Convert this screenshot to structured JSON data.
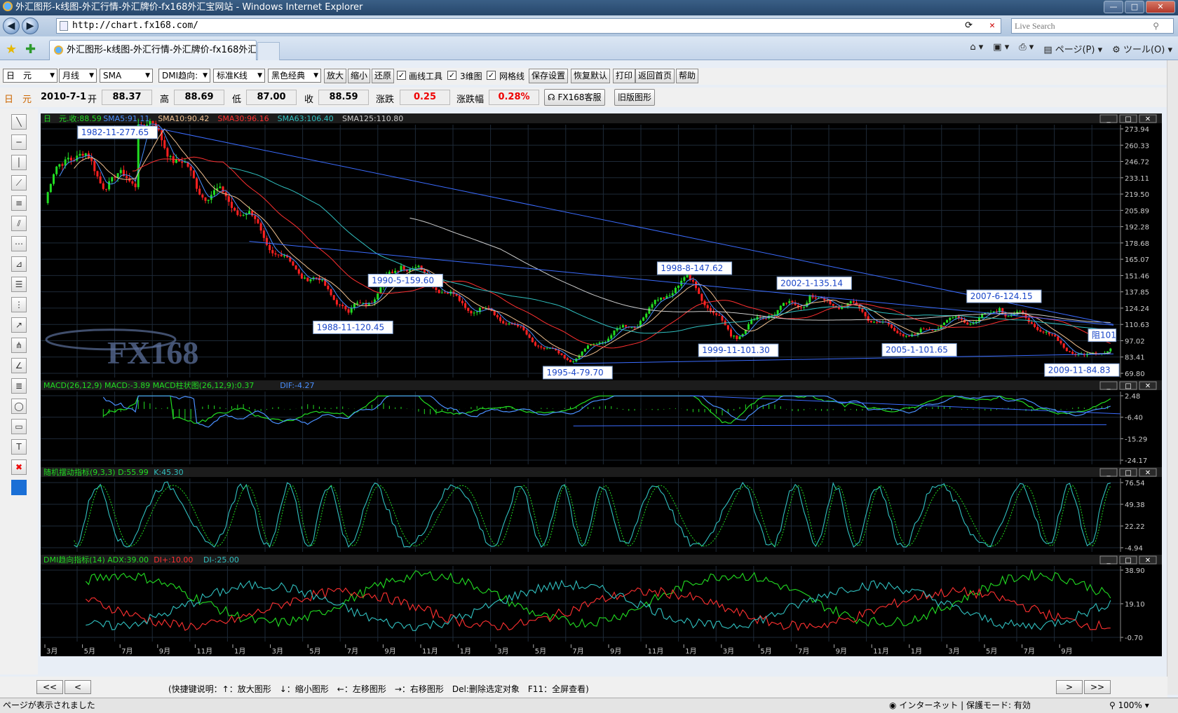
{
  "window": {
    "title": "外汇图形-k线图-外汇行情-外汇牌价-fx168外汇宝网站 - Windows Internet Explorer",
    "min": "—",
    "max": "□",
    "close": "✕"
  },
  "address": {
    "url": "http://chart.fx168.com/",
    "search_placeholder": "Live Search"
  },
  "tab": {
    "title": "外汇图形-k线图-外汇行情-外汇牌价-fx168外汇..."
  },
  "commands": {
    "page": "ページ(P)",
    "tools": "ツール(O)"
  },
  "toolbar": {
    "symbol": "日　元",
    "period": "月线",
    "ma": "SMA",
    "indicator": "DMI趋向:",
    "style": "标准K线",
    "theme": "黑色经典",
    "zoom_in": "放大",
    "zoom_out": "缩小",
    "restore": "还原",
    "draw_tools": "画线工具",
    "three_d": "3维图",
    "grid": "网格线",
    "save_settings": "保存设置",
    "reset": "恢复默认",
    "print": "打印",
    "home": "返回首页",
    "help": "帮助"
  },
  "quote": {
    "symbol": "日　元",
    "date": "2010-7-1",
    "open_label": "开",
    "open": "88.37",
    "high_label": "高",
    "high": "88.69",
    "low_label": "低",
    "low": "87.00",
    "close_label": "收",
    "close": "88.59",
    "change_label": "涨跌",
    "change": "0.25",
    "pct_label": "涨跌幅",
    "pct": "0.28%",
    "service_btn": "FX168客服",
    "old_chart_btn": "旧版图形"
  },
  "panels": {
    "main_header": [
      {
        "text": "日　元.收:88.59",
        "color": "#22dd22"
      },
      {
        "text": "SMA5:91.11",
        "color": "#4a90ff"
      },
      {
        "text": "SMA10:90.42",
        "color": "#f0c090"
      },
      {
        "text": "SMA30:96.16",
        "color": "#ff3030"
      },
      {
        "text": "SMA63:106.40",
        "color": "#30c0c0"
      },
      {
        "text": "SMA125:110.80",
        "color": "#cccccc"
      }
    ],
    "macd_header": [
      {
        "text": "MACD(26,12,9) MACD:-3.89 MACD柱状图(26,12,9):0.37",
        "color": "#22dd22"
      },
      {
        "text": "DIF:-4.27",
        "color": "#4a90ff"
      }
    ],
    "kdj_header": [
      {
        "text": "随机摆动指标(9,3,3) D:55.99",
        "color": "#22dd22"
      },
      {
        "text": "K:45.30",
        "color": "#30c0c0"
      }
    ],
    "dmi_header": [
      {
        "text": "DMI趋向指标(14) ADX:39.00",
        "color": "#22dd22"
      },
      {
        "text": "DI+:10.00",
        "color": "#ff3030"
      },
      {
        "text": "DI-:25.00",
        "color": "#30c0c0"
      }
    ],
    "main_ticks": [
      "273.94",
      "260.33",
      "246.72",
      "233.11",
      "219.50",
      "205.89",
      "192.28",
      "178.68",
      "165.07",
      "151.46",
      "137.85",
      "124.24",
      "110.63",
      "97.02",
      "83.41",
      "69.80"
    ],
    "macd_ticks": [
      "2.48",
      "-6.40",
      "-15.29",
      "-24.17"
    ],
    "kdj_ticks": [
      "76.54",
      "49.38",
      "22.22",
      "-4.94"
    ],
    "dmi_ticks": [
      "38.90",
      "19.10",
      "-0.70"
    ],
    "annotations": [
      "1982-11-277.65",
      "1990-5-159.60",
      "1988-11-120.45",
      "1995-4-79.70",
      "1998-8-147.62",
      "1999-11-101.30",
      "2002-1-135.14",
      "2005-1-101.65",
      "2007-6-124.15",
      "2009-11-84.83",
      "阻101"
    ],
    "x_ticks": [
      "3月",
      "5月",
      "7月",
      "9月",
      "11月",
      "1月",
      "3月",
      "5月",
      "7月",
      "9月",
      "11月",
      "1月",
      "3月",
      "5月",
      "7月",
      "9月",
      "11月",
      "1月",
      "3月",
      "5月",
      "7月",
      "9月",
      "11月",
      "1月",
      "3月",
      "5月",
      "7月",
      "9月"
    ],
    "watermark": "FX168",
    "panel_btns": [
      "_",
      "□",
      "✕"
    ]
  },
  "chart_data": {
    "type": "line",
    "title": "日　元",
    "period": "月线",
    "key_points": [
      {
        "label": "1982-11",
        "value": 277.65
      },
      {
        "label": "1988-11",
        "value": 120.45
      },
      {
        "label": "1990-5",
        "value": 159.6
      },
      {
        "label": "1995-4",
        "value": 79.7
      },
      {
        "label": "1998-8",
        "value": 147.62
      },
      {
        "label": "1999-11",
        "value": 101.3
      },
      {
        "label": "2002-1",
        "value": 135.14
      },
      {
        "label": "2005-1",
        "value": 101.65
      },
      {
        "label": "2007-6",
        "value": 124.15
      },
      {
        "label": "2009-11",
        "value": 84.83
      }
    ],
    "ylim": [
      69.8,
      273.94
    ]
  },
  "bottom": {
    "first": "<<",
    "prev": "<",
    "next": ">",
    "last": ">>",
    "hint": "(快捷键说明：↑：放大图形　↓：缩小图形　←：左移图形　→：右移图形　Del:删除选定对象　F11：全屏查看)"
  },
  "status": {
    "left": "ページが表示されました",
    "zone": "インターネット | 保護モード: 有効",
    "zoom": "100%"
  }
}
